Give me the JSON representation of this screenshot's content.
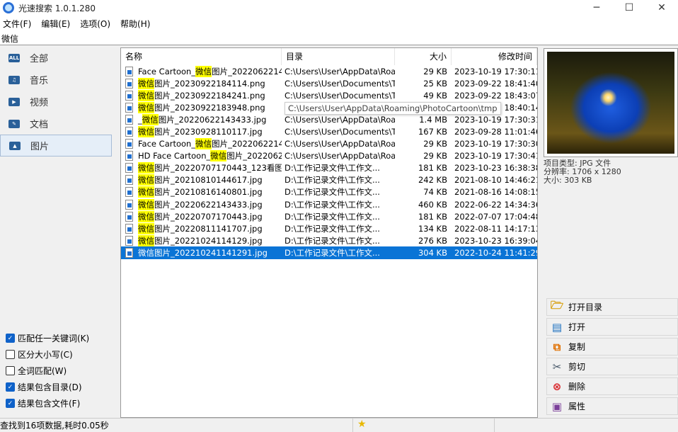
{
  "window": {
    "title": "光速搜索 1.0.1.280",
    "minimize": "─",
    "maximize": "☐",
    "close": "✕"
  },
  "menu": [
    "文件(F)",
    "编辑(E)",
    "选项(O)",
    "帮助(H)"
  ],
  "search": {
    "value": "微信"
  },
  "categories": [
    {
      "label": "全部",
      "icon": "all-icon",
      "glyph": "ALL"
    },
    {
      "label": "音乐",
      "icon": "music-icon",
      "glyph": "♫"
    },
    {
      "label": "视频",
      "icon": "video-icon",
      "glyph": "▶"
    },
    {
      "label": "文档",
      "icon": "document-icon",
      "glyph": "✎"
    },
    {
      "label": "图片",
      "icon": "image-icon",
      "glyph": "▲",
      "selected": true
    }
  ],
  "options": [
    {
      "label": "匹配任一关键词(K)",
      "checked": true
    },
    {
      "label": "区分大小写(C)",
      "checked": false
    },
    {
      "label": "全词匹配(W)",
      "checked": false
    },
    {
      "label": "结果包含目录(D)",
      "checked": true
    },
    {
      "label": "结果包含文件(F)",
      "checked": true
    }
  ],
  "columns": {
    "name": "名称",
    "dir": "目录",
    "size": "大小",
    "modified": "修改时间"
  },
  "rows": [
    {
      "pre": "Face Cartoon_",
      "hl": "微信",
      "post": "图片_2022062214...",
      "dir": "C:\\Users\\User\\AppData\\Roa...",
      "size": "29 KB",
      "modified": "2023-10-19 17:30:11"
    },
    {
      "pre": "",
      "hl": "微信",
      "post": "图片_20230922184114.png",
      "dir": "C:\\Users\\User\\Documents\\T...",
      "size": "25 KB",
      "modified": "2023-09-22 18:41:40"
    },
    {
      "pre": "",
      "hl": "微信",
      "post": "图片_20230922184241.png",
      "dir": "C:\\Users\\User\\Documents\\T...",
      "size": "49 KB",
      "modified": "2023-09-22 18:43:07"
    },
    {
      "pre": "",
      "hl": "微信",
      "post": "图片_20230922183948.png",
      "dir": "C:\\Users\\User\\Documents\\T...",
      "size": "",
      "modified": "2023-09-22 18:40:14"
    },
    {
      "pre": "_",
      "hl": "微信",
      "post": "图片_20220622143433.jpg",
      "dir": "C:\\Users\\User\\AppData\\Roa...",
      "size": "1.4 MB",
      "modified": "2023-10-19 17:30:31"
    },
    {
      "pre": "",
      "hl": "微信",
      "post": "图片_20230928110117.jpg",
      "dir": "C:\\Users\\User\\Documents\\T...",
      "size": "167 KB",
      "modified": "2023-09-28 11:01:46"
    },
    {
      "pre": "Face Cartoon_",
      "hl": "微信",
      "post": "图片_2022062214...",
      "dir": "C:\\Users\\User\\AppData\\Roa...",
      "size": "29 KB",
      "modified": "2023-10-19 17:30:30"
    },
    {
      "pre": "HD Face Cartoon_",
      "hl": "微信",
      "post": "图片_2022062...",
      "dir": "C:\\Users\\User\\AppData\\Roa...",
      "size": "29 KB",
      "modified": "2023-10-19 17:30:41"
    },
    {
      "pre": "",
      "hl": "微信",
      "post": "图片_20220707170443_123看图...",
      "dir": "D:\\工作记录文件\\工作文...",
      "size": "181 KB",
      "modified": "2023-10-23 16:38:38"
    },
    {
      "pre": "",
      "hl": "微信",
      "post": "图片_20210810144617.jpg",
      "dir": "D:\\工作记录文件\\工作文...",
      "size": "242 KB",
      "modified": "2021-08-10 14:46:21"
    },
    {
      "pre": "",
      "hl": "微信",
      "post": "图片_20210816140801.jpg",
      "dir": "D:\\工作记录文件\\工作文...",
      "size": "74 KB",
      "modified": "2021-08-16 14:08:15"
    },
    {
      "pre": "",
      "hl": "微信",
      "post": "图片_20220622143433.jpg",
      "dir": "D:\\工作记录文件\\工作文...",
      "size": "460 KB",
      "modified": "2022-06-22 14:34:36"
    },
    {
      "pre": "",
      "hl": "微信",
      "post": "图片_20220707170443.jpg",
      "dir": "D:\\工作记录文件\\工作文...",
      "size": "181 KB",
      "modified": "2022-07-07 17:04:48"
    },
    {
      "pre": "",
      "hl": "微信",
      "post": "图片_20220811141707.jpg",
      "dir": "D:\\工作记录文件\\工作文...",
      "size": "134 KB",
      "modified": "2022-08-11 14:17:13"
    },
    {
      "pre": "",
      "hl": "微信",
      "post": "图片_20221024114129.jpg",
      "dir": "D:\\工作记录文件\\工作文...",
      "size": "276 KB",
      "modified": "2023-10-23 16:39:04"
    },
    {
      "pre": "",
      "hl": "",
      "post": "微信图片_20221024114129 1.jpg",
      "dir": "D:\\工作记录文件\\工作文...",
      "size": "304 KB",
      "modified": "2022-10-24 11:41:29",
      "selected": true
    }
  ],
  "tooltip": "C:\\Users\\User\\AppData\\Roaming\\PhotoCartoon\\tmp",
  "info": {
    "type": "项目类型: JPG 文件",
    "resolution": "分辨率: 1706 x 1280",
    "size": "大小: 303 KB"
  },
  "actions": [
    {
      "label": "打开目录",
      "icon": "folder-open-icon",
      "glyph": "🗁",
      "color": "#d69b00"
    },
    {
      "label": "打开",
      "icon": "open-file-icon",
      "glyph": "▤",
      "color": "#1a6fbf"
    },
    {
      "label": "复制",
      "icon": "copy-icon",
      "glyph": "⧉",
      "color": "#e07000"
    },
    {
      "label": "剪切",
      "icon": "scissors-icon",
      "glyph": "✂",
      "color": "#445566"
    },
    {
      "label": "删除",
      "icon": "delete-icon",
      "glyph": "⊗",
      "color": "#d9262b"
    },
    {
      "label": "属性",
      "icon": "properties-icon",
      "glyph": "▣",
      "color": "#7b3f9a"
    }
  ],
  "status": {
    "text": "查找到16项数据,耗时0.05秒",
    "star": "★"
  }
}
